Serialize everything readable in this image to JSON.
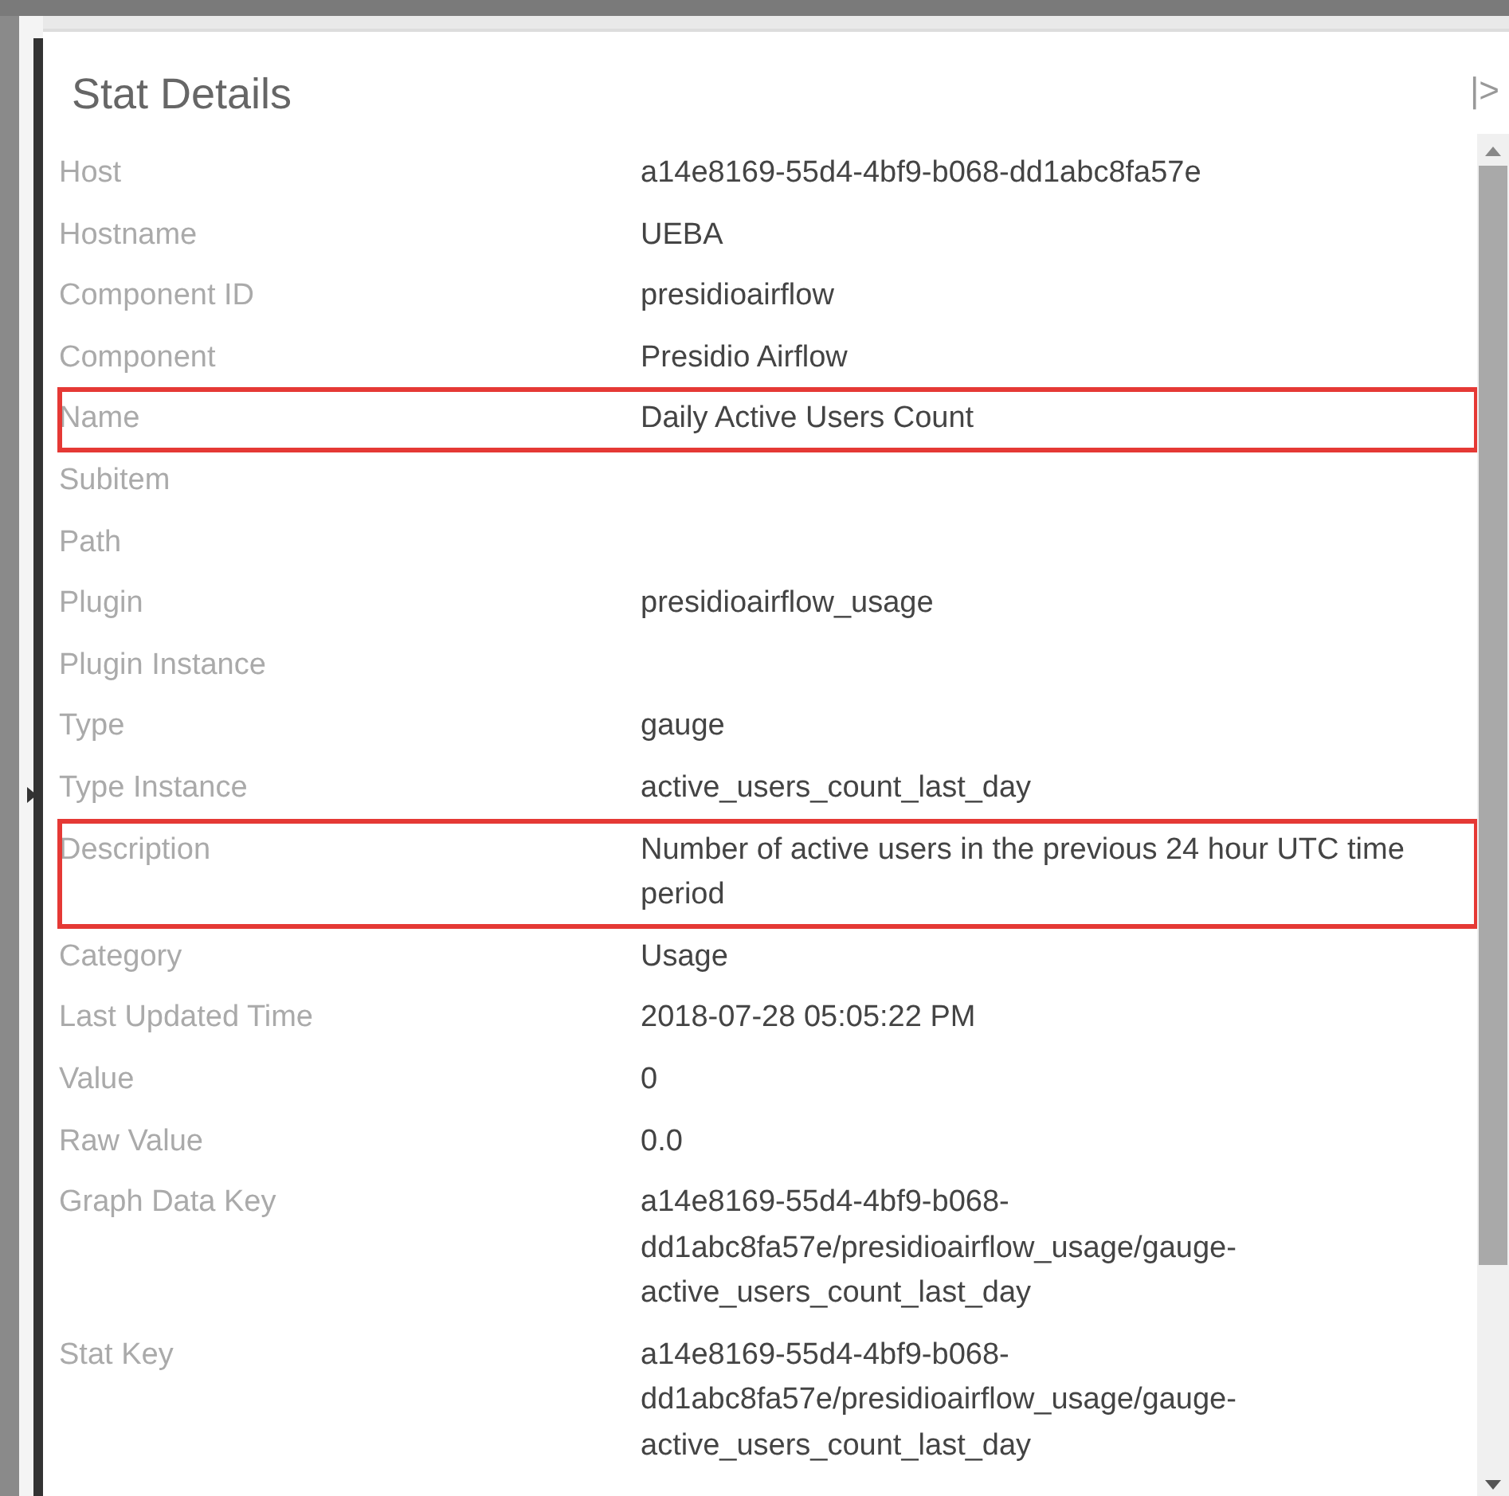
{
  "panel": {
    "title": "Stat Details",
    "collapse_icon": "|>"
  },
  "rows": [
    {
      "label": "Host",
      "value": "a14e8169-55d4-4bf9-b068-dd1abc8fa57e",
      "highlighted": false
    },
    {
      "label": "Hostname",
      "value": "UEBA",
      "highlighted": false
    },
    {
      "label": "Component ID",
      "value": "presidioairflow",
      "highlighted": false
    },
    {
      "label": "Component",
      "value": "Presidio Airflow",
      "highlighted": false
    },
    {
      "label": "Name",
      "value": "Daily Active Users Count",
      "highlighted": true
    },
    {
      "label": "Subitem",
      "highlighted": false
    },
    {
      "label": "Path",
      "highlighted": false
    },
    {
      "label": "Plugin",
      "value": "presidioairflow_usage",
      "highlighted": false
    },
    {
      "label": "Plugin Instance",
      "highlighted": false
    },
    {
      "label": "Type",
      "value": "gauge",
      "highlighted": false
    },
    {
      "label": "Type Instance",
      "value": "active_users_count_last_day",
      "highlighted": false
    },
    {
      "label": "Description",
      "value": "Number of active users in the previous 24 hour UTC time period",
      "highlighted": true
    },
    {
      "label": "Category",
      "value": "Usage",
      "highlighted": false
    },
    {
      "label": "Last Updated Time",
      "value": "2018-07-28 05:05:22 PM",
      "highlighted": false
    },
    {
      "label": "Value",
      "value": "0",
      "highlighted": false
    },
    {
      "label": "Raw Value",
      "value": "0.0",
      "highlighted": false
    },
    {
      "label": "Graph Data Key",
      "value": "a14e8169-55d4-4bf9-b068-dd1abc8fa57e/presidioairflow_usage/gauge-active_users_count_last_day",
      "highlighted": false
    },
    {
      "label": "Stat Key",
      "value": "a14e8169-55d4-4bf9-b068-dd1abc8fa57e/presidioairflow_usage/gauge-active_users_count_last_day",
      "highlighted": false
    }
  ]
}
